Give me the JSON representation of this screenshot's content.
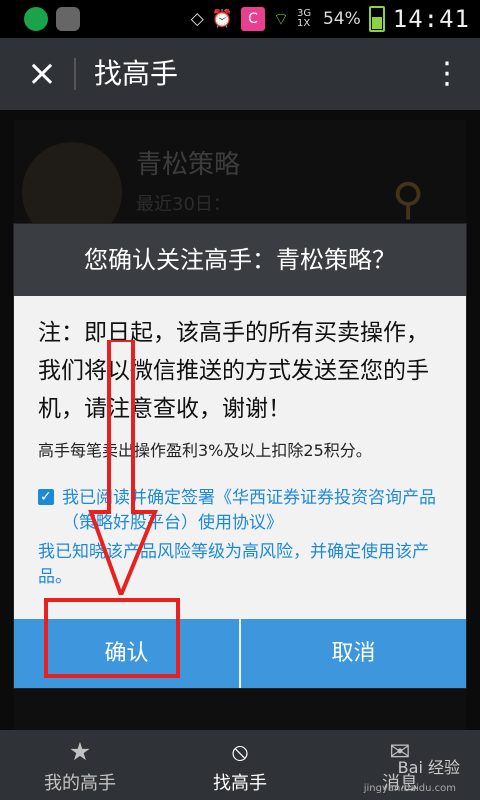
{
  "status_bar": {
    "battery": "54%",
    "time": "14:41",
    "network": "3G 1X",
    "app_icon": "C"
  },
  "appbar": {
    "title": "找高手"
  },
  "background_list": [
    {
      "name": "青松策略",
      "detail": "最近30日："
    }
  ],
  "dialog": {
    "title": "您确认关注高手：青松策略？",
    "note": "注：即日起，该高手的所有买卖操作，我们将以微信推送的方式发送至您的手机，请注意查收，谢谢！",
    "bonus": "高手每笔卖出操作盈利3%及以上扣除25积分。",
    "agreement": "我已阅读并确定签署《华西证券证券投资咨询产品（策略好股平台）使用协议》",
    "risk": "我已知晓该产品风险等级为高风险，并确定使用该产品。",
    "confirm": "确认",
    "cancel": "取消",
    "checked": true
  },
  "bottom_nav": {
    "items": [
      {
        "label": "我的高手",
        "icon": "star-icon"
      },
      {
        "label": "找高手",
        "icon": "compass-icon"
      },
      {
        "label": "消息",
        "icon": "mail-icon"
      }
    ]
  },
  "watermark": {
    "text": "Bai 经验",
    "url": "jingyan.baidu.com"
  },
  "colors": {
    "accent": "#3e96dd",
    "highlight": "#e92020",
    "title_bar": "#3a3d41"
  }
}
